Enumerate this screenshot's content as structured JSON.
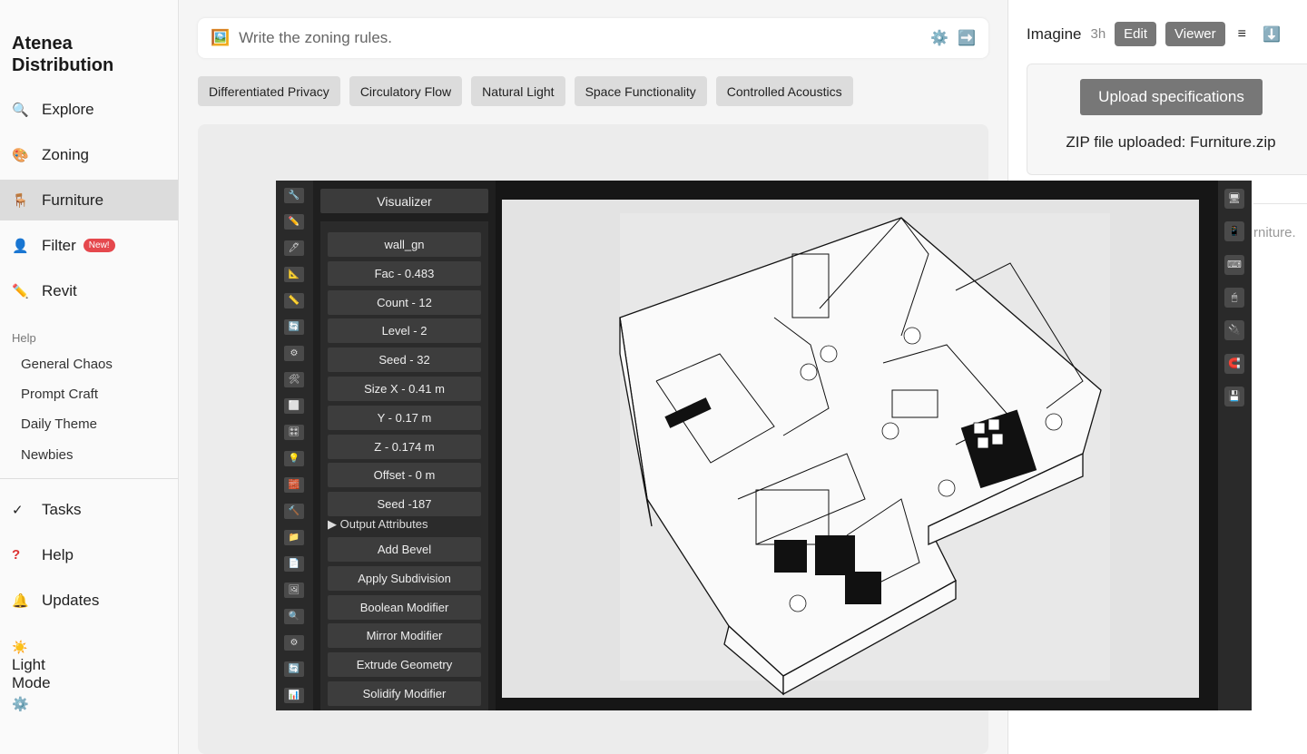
{
  "sidebar": {
    "brand": "Atenea\nDistribution",
    "nav": [
      {
        "label": "Explore",
        "icon": "🔍"
      },
      {
        "label": "Zoning",
        "icon": "🎨"
      },
      {
        "label": "Furniture",
        "icon": "🪑"
      },
      {
        "label": "Filter",
        "icon": "👤",
        "badge": "New!"
      },
      {
        "label": "Revit",
        "icon": "✏️"
      }
    ],
    "help_heading": "Help",
    "help_links": [
      "General Chaos",
      "Prompt Craft",
      "Daily Theme",
      "Newbies"
    ],
    "bottom_nav": [
      {
        "label": "Tasks",
        "icon": "✓"
      },
      {
        "label": "Help",
        "icon": "?"
      },
      {
        "label": "Updates",
        "icon": "🔔"
      }
    ],
    "mode_label": "Light Mode",
    "mode_icon": "☀️",
    "mode_settings_icon": "⚙️"
  },
  "prompt": {
    "placeholder": "Write the zoning rules.",
    "image_icon": "🖼️",
    "settings_icon": "⚙️",
    "submit_icon": "➡️"
  },
  "chips": [
    "Differentiated Privacy",
    "Circulatory Flow",
    "Natural Light",
    "Space Functionality",
    "Controlled Acoustics"
  ],
  "right_panel": {
    "title": "Imagine",
    "time": "3h",
    "edit_label": "Edit",
    "viewer_label": "Viewer",
    "menu_icon": "≡",
    "download_icon": "⬇️",
    "upload_label": "Upload specifications",
    "zip_status": "ZIP file uploaded: Furniture.zip",
    "faint_text": "rniture."
  },
  "viewer": {
    "title": "Visualizer",
    "params": [
      "wall_gn",
      "Fac - 0.483",
      "Count - 12",
      "Level - 2",
      "Seed - 32",
      "Size X - 0.41 m",
      "Y - 0.17 m",
      "Z - 0.174 m",
      "Offset - 0 m",
      "Seed -187"
    ],
    "output_attributes": "▶ Output Attributes",
    "modifiers": [
      "Add Bevel",
      "Apply Subdivision",
      "Boolean Modifier",
      "Mirror Modifier",
      "Extrude Geometry",
      "Solidify Modifier"
    ],
    "left_tools": [
      "🔧",
      "✏️",
      "🖊",
      "📐",
      "📏",
      "🔄",
      "⚙",
      "🛠",
      "⬜",
      "🎛",
      "💡",
      "🧱",
      "🔨",
      "📁",
      "📄",
      "🖼",
      "🔍",
      "⚙",
      "🔄",
      "📊"
    ],
    "right_tools": [
      "🖥",
      "📱",
      "⌨",
      "🖱",
      "🔌",
      "🧲",
      "💾"
    ]
  },
  "colors": {
    "active_nav": "#dcdcdc",
    "badge": "#e5484d",
    "viewer_bg": "#161616"
  }
}
